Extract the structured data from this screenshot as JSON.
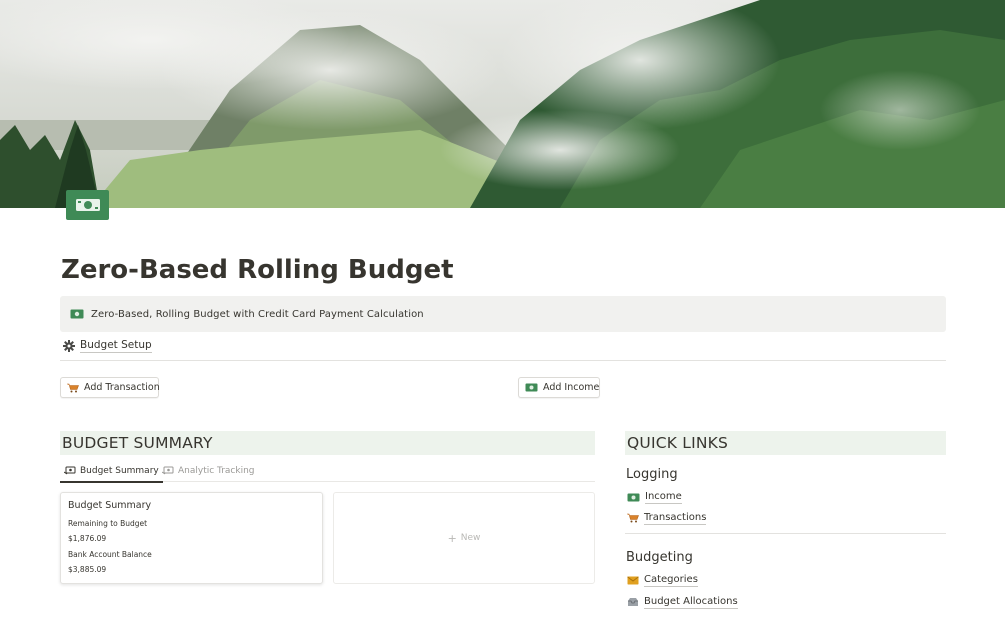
{
  "page": {
    "title": "Zero-Based Rolling Budget",
    "icon": "money-icon"
  },
  "callout": {
    "icon": "money-icon",
    "text": "Zero-Based, Rolling Budget with Credit Card Payment Calculation"
  },
  "setup_link": {
    "icon": "gear-icon",
    "label": "Budget Setup"
  },
  "buttons": {
    "add_transaction": {
      "icon": "cart-icon",
      "label": "Add Transaction"
    },
    "add_income": {
      "icon": "money-icon",
      "label": "Add Income"
    }
  },
  "budget_summary": {
    "heading": "BUDGET SUMMARY",
    "tabs": [
      {
        "icon": "money-with-wings-icon",
        "label": "Budget Summary",
        "active": true
      },
      {
        "icon": "money-with-wings-icon",
        "label": "Analytic Tracking",
        "active": false
      }
    ],
    "card": {
      "title": "Budget Summary",
      "remaining_label": "Remaining to Budget",
      "remaining_value": "$1,876.09",
      "balance_label": "Bank Account Balance",
      "balance_value": "$3,885.09"
    },
    "new_card": {
      "plus": "+",
      "label": "New"
    }
  },
  "quick_links": {
    "heading": "QUICK LINKS",
    "logging": {
      "heading": "Logging",
      "links": [
        {
          "icon": "money-icon",
          "label": "Income"
        },
        {
          "icon": "cart-icon",
          "label": "Transactions"
        }
      ]
    },
    "budgeting": {
      "heading": "Budgeting",
      "links": [
        {
          "icon": "envelope-icon",
          "label": "Categories"
        },
        {
          "icon": "inbox-tray-icon",
          "label": "Budget Allocations"
        }
      ]
    }
  },
  "colors": {
    "accent_green": "#3f8a56",
    "section_header_bg": "#edf3ec",
    "callout_bg": "#f1f1ef",
    "cart_orange": "#d9822b"
  }
}
